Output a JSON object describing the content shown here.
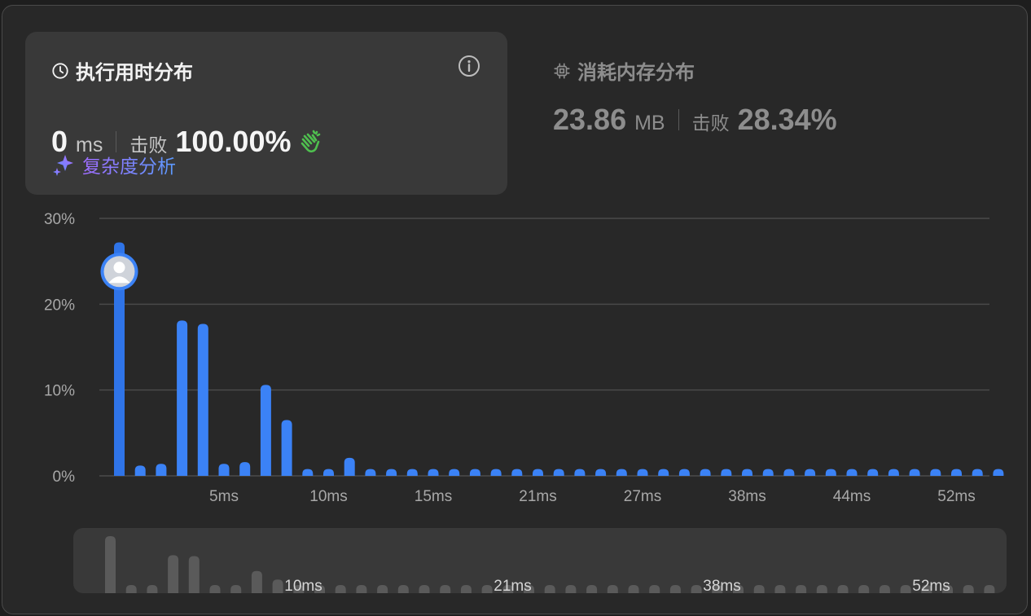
{
  "runtime": {
    "title": "执行用时分布",
    "value": "0",
    "unit": "ms",
    "beats_label": "击败",
    "beats_value": "100.00%",
    "complexity_label": "复杂度分析"
  },
  "memory": {
    "title": "消耗内存分布",
    "value": "23.86",
    "unit": "MB",
    "beats_label": "击败",
    "beats_value": "28.34%"
  },
  "colors": {
    "bar": "#3b82f6",
    "bar_active": "#2f74e8",
    "overview_bar": "#5a5a5a",
    "grid": "#4a4a4a"
  },
  "chart_data": {
    "type": "bar",
    "ylim": [
      0,
      30
    ],
    "y_ticks": [
      "0%",
      "10%",
      "20%",
      "30%"
    ],
    "x_tick_labels": [
      {
        "index": 5,
        "label": "5ms"
      },
      {
        "index": 10,
        "label": "10ms"
      },
      {
        "index": 15,
        "label": "15ms"
      },
      {
        "index": 20,
        "label": "21ms"
      },
      {
        "index": 25,
        "label": "27ms"
      },
      {
        "index": 30,
        "label": "38ms"
      },
      {
        "index": 35,
        "label": "44ms"
      },
      {
        "index": 40,
        "label": "52ms"
      }
    ],
    "values": [
      27.2,
      1.2,
      1.4,
      18.1,
      17.7,
      1.4,
      1.6,
      10.6,
      6.5,
      0.8,
      0.8,
      2.1,
      0.8,
      0.8,
      0.8,
      0.8,
      0.8,
      0.8,
      0.8,
      0.8,
      0.8,
      0.8,
      0.8,
      0.8,
      0.8,
      0.8,
      0.8,
      0.8,
      0.8,
      0.8,
      0.8,
      0.8,
      0.8,
      0.8,
      0.8,
      0.8,
      0.8,
      0.8,
      0.8,
      0.8,
      0.8,
      0.8,
      0.8
    ],
    "user_bar_index": 0,
    "user_marker_value": 23.8,
    "overview_tick_labels": [
      {
        "index": 10,
        "label": "10ms"
      },
      {
        "index": 20,
        "label": "21ms"
      },
      {
        "index": 30,
        "label": "38ms"
      },
      {
        "index": 40,
        "label": "52ms"
      }
    ]
  }
}
